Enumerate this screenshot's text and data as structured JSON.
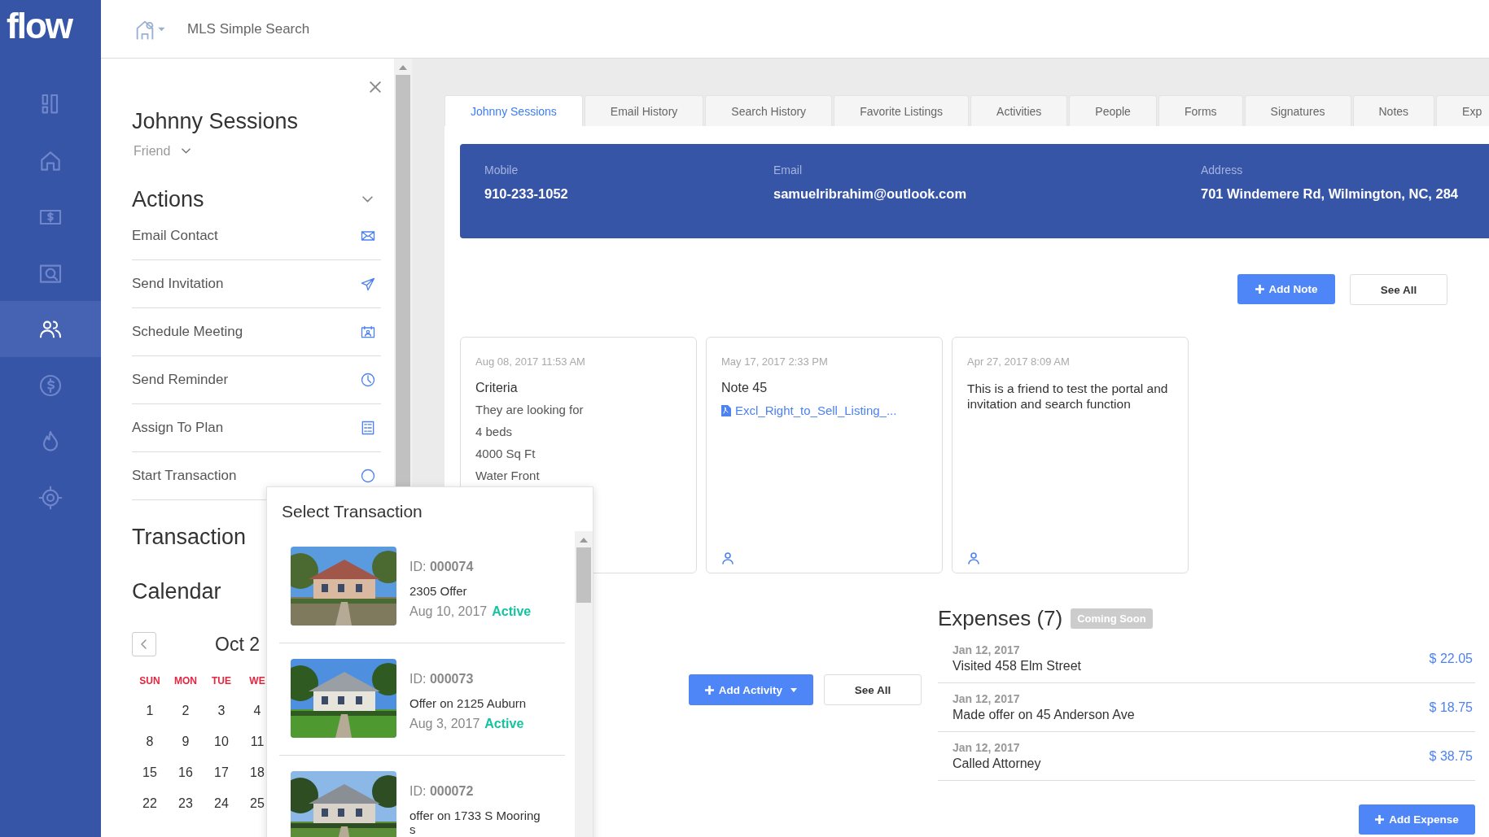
{
  "logo": "flow",
  "sidebar": {
    "items": [
      {
        "selected": false
      },
      {
        "selected": false
      },
      {
        "selected": false
      },
      {
        "selected": false
      },
      {
        "selected": true
      },
      {
        "selected": false
      },
      {
        "selected": false
      },
      {
        "selected": false
      }
    ]
  },
  "top_bar": {
    "title": "MLS Simple Search"
  },
  "contact_panel": {
    "name": "Johnny Sessions",
    "relationship": "Friend",
    "actions_title": "Actions",
    "actions": [
      {
        "label": "Email Contact"
      },
      {
        "label": "Send Invitation"
      },
      {
        "label": "Schedule Meeting"
      },
      {
        "label": "Send Reminder"
      },
      {
        "label": "Assign To Plan"
      },
      {
        "label": "Start Transaction"
      }
    ],
    "transactions_title": "Transaction",
    "calendar": {
      "title": "Calendar",
      "month": "Oct 2",
      "weekdays": [
        "SUN",
        "MON",
        "TUE",
        "WE"
      ],
      "weeks": [
        [
          "1",
          "2",
          "3",
          "4"
        ],
        [
          "8",
          "9",
          "10",
          "11"
        ],
        [
          "15",
          "16",
          "17",
          "18"
        ],
        [
          "22",
          "23",
          "24",
          "25"
        ]
      ]
    }
  },
  "tabs": [
    {
      "label": "Johnny Sessions",
      "selected": true
    },
    {
      "label": "Email History",
      "selected": false
    },
    {
      "label": "Search History",
      "selected": false
    },
    {
      "label": "Favorite Listings",
      "selected": false
    },
    {
      "label": "Activities",
      "selected": false
    },
    {
      "label": "People",
      "selected": false
    },
    {
      "label": "Forms",
      "selected": false
    },
    {
      "label": "Signatures",
      "selected": false
    },
    {
      "label": "Notes",
      "selected": false
    },
    {
      "label": "Exp",
      "selected": false
    }
  ],
  "contact_info": [
    {
      "label": "Mobile",
      "value": "910-233-1052"
    },
    {
      "label": "Email",
      "value": "samuelribrahim@outlook.com"
    },
    {
      "label": "Address",
      "value": "701 Windemere Rd, Wilmington, NC, 284"
    }
  ],
  "notes": {
    "add_button": "Add Note",
    "see_all_button": "See All",
    "cards": [
      {
        "date": "Aug 08, 2017 11:53 AM",
        "title": "Criteria",
        "lines": [
          "They are looking for",
          "4 beds",
          "4000 Sq Ft",
          "Water Front"
        ]
      },
      {
        "date": "May 17, 2017 2:33 PM",
        "title": "Note 45",
        "attachment": "Excl_Right_to_Sell_Listing_...",
        "author": true
      },
      {
        "date": "Apr 27, 2017 8:09 AM",
        "body": "This is a friend to test the portal and invitation and search function",
        "author": true
      }
    ]
  },
  "activities": {
    "add_button": "Add Activity",
    "see_all_button": "See All"
  },
  "expenses": {
    "title": "Expenses (7)",
    "badge": "Coming Soon",
    "items": [
      {
        "date": "Jan 12, 2017",
        "description": "Visited 458 Elm Street",
        "amount": "$ 22.05"
      },
      {
        "date": "Jan 12, 2017",
        "description": "Made offer on 45 Anderson Ave",
        "amount": "$ 18.75"
      },
      {
        "date": "Jan 12, 2017",
        "description": "Called Attorney",
        "amount": "$ 38.75"
      }
    ],
    "add_button": "Add Expense"
  },
  "transaction_popup": {
    "title": "Select Transaction",
    "items": [
      {
        "id_label": "ID:",
        "id": "000074",
        "title": "2305 Offer",
        "date": "Aug 10, 2017",
        "status": "Active"
      },
      {
        "id_label": "ID:",
        "id": "000073",
        "title": "Offer on 2125 Auburn",
        "date": "Aug 3, 2017",
        "status": "Active"
      },
      {
        "id_label": "ID:",
        "id": "000072",
        "title": "offer on 1733 S Mooring s"
      }
    ]
  }
}
